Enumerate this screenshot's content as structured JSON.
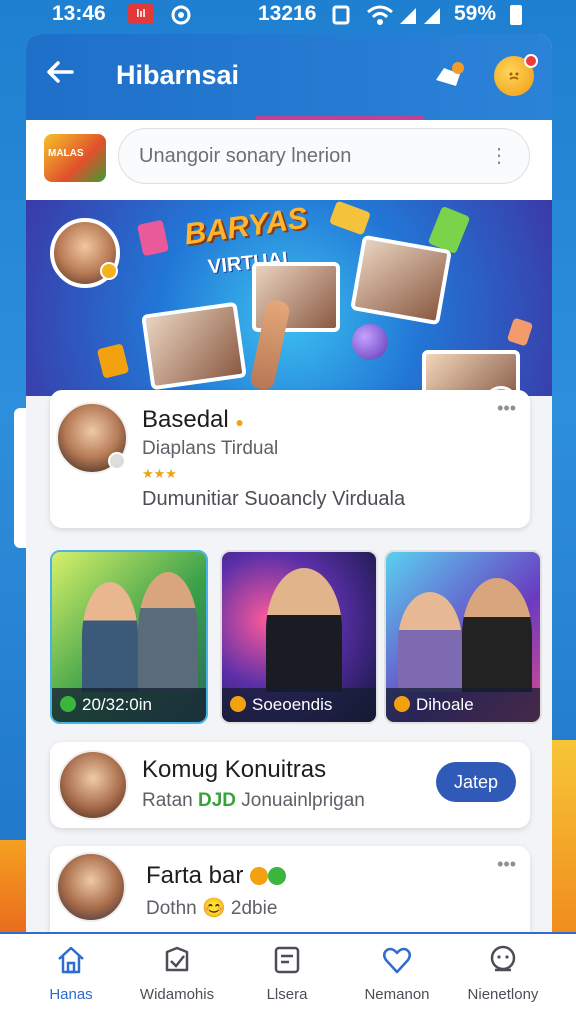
{
  "status_bar": {
    "time": "13:46",
    "badge": "lıl",
    "center": "13216",
    "battery": "59%"
  },
  "app_bar": {
    "title": "Hibarnsai"
  },
  "search": {
    "logo_text": "MALAS",
    "placeholder": "Unangoir sonary lnerion"
  },
  "banner": {
    "title": "BARYAS",
    "subtitle": "VIRTUAL"
  },
  "profile": {
    "name": "Basedal",
    "subtitle": "Diaplans Tirdual",
    "rating": "★★★",
    "description": "Dumunitiar Suoancly Virduala"
  },
  "tiles": [
    {
      "label": "20/32:0in"
    },
    {
      "label": "Soeoendis"
    },
    {
      "label": "Dihoale"
    }
  ],
  "community": {
    "title": "Komug Konuitras",
    "subtitle_prefix": "Ratan ",
    "subtitle_tag": "DJD",
    "subtitle_suffix": " Jonuainlprigan",
    "join_label": "Jatep"
  },
  "post": {
    "title": "Farta bar",
    "subtitle": "Dothn 😊 2dbie"
  },
  "nav": [
    {
      "label": "Hanas",
      "icon": "home-icon",
      "active": true
    },
    {
      "label": "Widamohis",
      "icon": "check-icon"
    },
    {
      "label": "Llsera",
      "icon": "note-icon"
    },
    {
      "label": "Nemanon",
      "icon": "heart-icon"
    },
    {
      "label": "Nienetlony",
      "icon": "chat-face-icon"
    }
  ],
  "colors": {
    "primary": "#2f6bd0",
    "accent": "#f2a10f",
    "appbar": "#1e6fc8"
  }
}
